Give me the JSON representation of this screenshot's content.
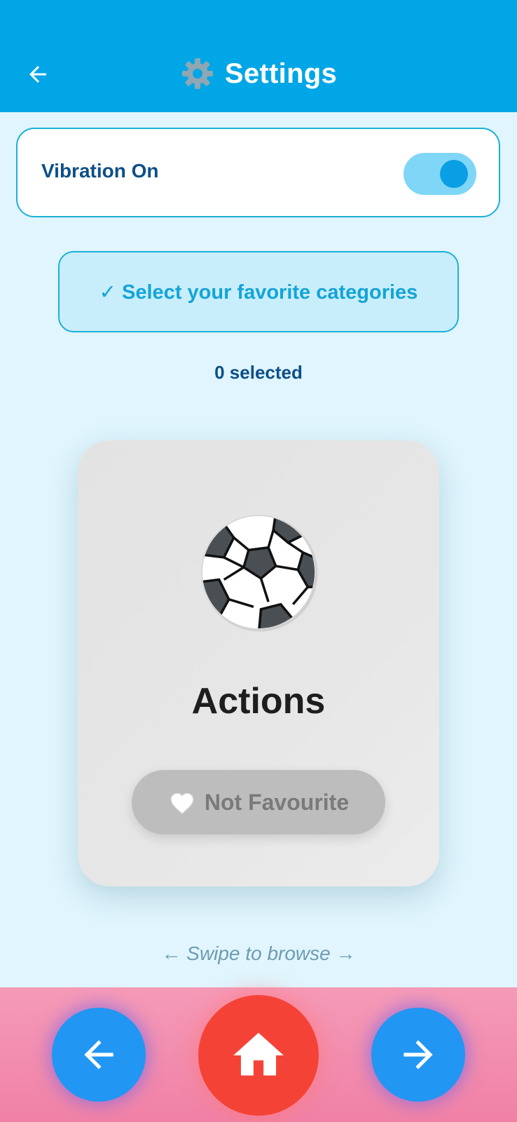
{
  "header": {
    "title": "Settings",
    "back_icon": "arrow-left-icon",
    "title_icon": "gear-icon"
  },
  "vibration": {
    "label": "Vibration On",
    "enabled": true
  },
  "categories": {
    "prompt": "✓ Select your favorite categories",
    "selected_count_text": "0 selected"
  },
  "card": {
    "icon": "soccer-ball-icon",
    "title": "Actions",
    "favourite_button": {
      "icon": "white-heart-icon",
      "label": "Not Favourite"
    }
  },
  "swipe_hint": "← Swipe to browse →",
  "bottom_nav": {
    "prev_icon": "arrow-left-icon",
    "home_icon": "home-icon",
    "next_icon": "arrow-right-icon"
  },
  "colors": {
    "app_bar": "#00a6e6",
    "background": "#e0f5fd",
    "accent_text": "#0d4f88",
    "category_text": "#14a4d8",
    "home_button": "#f44336",
    "nav_button": "#2196f3",
    "bottom_bar": "#f59ab8"
  }
}
